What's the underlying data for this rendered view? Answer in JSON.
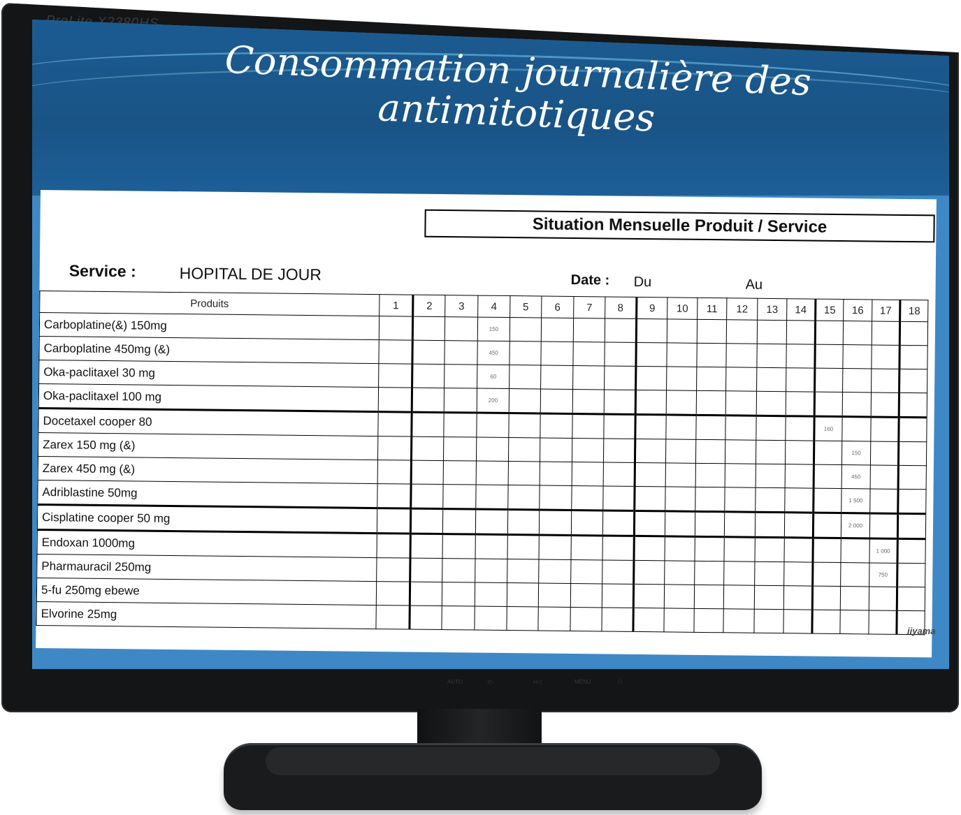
{
  "monitor": {
    "model_label": "ProLite X2380HS",
    "brand": "iiyama",
    "controls": [
      "AUTO",
      "-/▷",
      "+/◁",
      "MENU",
      "⏻"
    ]
  },
  "slide": {
    "title_line1": "Consommation journalière des",
    "title_line2": "antimitotiques"
  },
  "document": {
    "header": "Situation Mensuelle Produit / Service",
    "service_label": "Service :",
    "service_value": "HOPITAL DE JOUR",
    "date_label": "Date :",
    "date_from": "Du",
    "date_to": "Au",
    "column_header": "Produits",
    "day_columns": [
      "1",
      "2",
      "3",
      "4",
      "5",
      "6",
      "7",
      "8",
      "9",
      "10",
      "11",
      "12",
      "13",
      "14",
      "15",
      "16",
      "17",
      "18"
    ],
    "products": [
      "Carboplatine(&) 150mg",
      "Carboplatine 450mg (&)",
      "Oka-paclitaxel 30 mg",
      "Oka-paclitaxel 100 mg",
      "Docetaxel cooper 80",
      "Zarex 150 mg (&)",
      "Zarex 450 mg (&)",
      "Adriblastine 50mg",
      "Cisplatine cooper 50 mg",
      "Endoxan 1000mg",
      "Pharmauracil 250mg",
      "5-fu 250mg  ebewe",
      "Elvorine 25mg"
    ],
    "entries": [
      {
        "row": 0,
        "day": 4,
        "value": "150"
      },
      {
        "row": 1,
        "day": 4,
        "value": "450"
      },
      {
        "row": 2,
        "day": 4,
        "value": "60"
      },
      {
        "row": 3,
        "day": 4,
        "value": "200"
      },
      {
        "row": 4,
        "day": 15,
        "value": "160"
      },
      {
        "row": 5,
        "day": 16,
        "value": "150"
      },
      {
        "row": 6,
        "day": 16,
        "value": "450"
      },
      {
        "row": 7,
        "day": 16,
        "value": "1 500"
      },
      {
        "row": 8,
        "day": 16,
        "value": "2 000"
      },
      {
        "row": 9,
        "day": 17,
        "value": "1 000"
      },
      {
        "row": 10,
        "day": 17,
        "value": "750"
      }
    ]
  }
}
